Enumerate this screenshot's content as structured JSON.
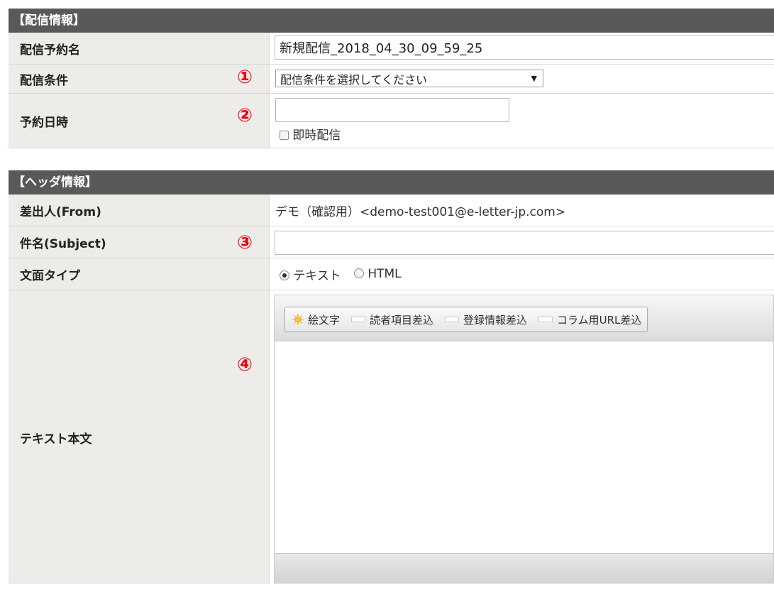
{
  "delivery": {
    "title": "【配信情報】",
    "reservation_name_label": "配信予約名",
    "reservation_name_value": "新規配信_2018_04_30_09_59_25",
    "condition_label": "配信条件",
    "condition_mark": "①",
    "condition_selected": "配信条件を選択してください",
    "datetime_label": "予約日時",
    "datetime_mark": "②",
    "datetime_value": "",
    "immediate_label": "即時配信"
  },
  "header": {
    "title": "【ヘッダ情報】",
    "from_label": "差出人(From)",
    "from_value": "デモ（確認用）<demo-test001@e-letter-jp.com>",
    "subject_label": "件名(Subject)",
    "subject_mark": "③",
    "subject_value": "",
    "type_label": "文面タイプ",
    "type_options": [
      {
        "label": "テキスト",
        "selected": true
      },
      {
        "label": "HTML",
        "selected": false
      }
    ],
    "body_label": "テキスト本文",
    "body_mark": "④",
    "toolbar": {
      "emoji": "絵文字",
      "reader_fields": "読者項目差込",
      "registration_info": "登録情報差込",
      "column_url": "コラム用URL差込"
    }
  },
  "colors": {
    "section_header_bg": "#595959",
    "label_bg": "#eeece8",
    "mark_red": "#e60012"
  }
}
